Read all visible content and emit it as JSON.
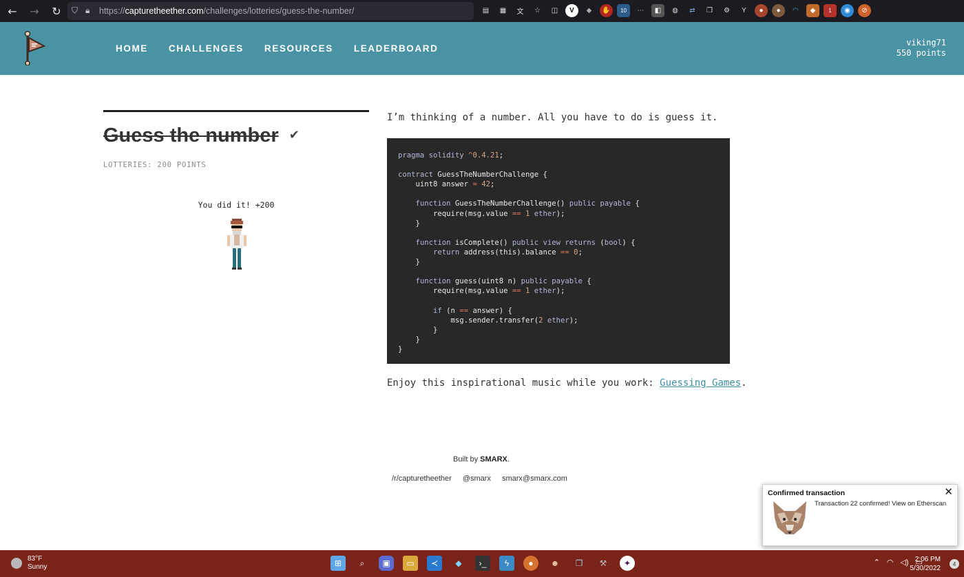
{
  "browser": {
    "url_scheme": "https://",
    "url_host": "capturetheether.com",
    "url_path": "/challenges/lotteries/guess-the-number/",
    "badge_10": "10",
    "badge_1": "1"
  },
  "header": {
    "nav": [
      "HOME",
      "CHALLENGES",
      "RESOURCES",
      "LEADERBOARD"
    ],
    "username": "viking71",
    "points": "550 points",
    "bg_color": "#4a93a4"
  },
  "challenge": {
    "title": "Guess the number",
    "check_icon": "✔",
    "subtitle": "LOTTERIES: 200 POINTS",
    "success_text": "You did it! +200"
  },
  "content": {
    "intro": "I’m thinking of a number. All you have to do is guess it.",
    "code_lines": [
      "pragma solidity ^0.4.21;",
      "",
      "contract GuessTheNumberChallenge {",
      "    uint8 answer = 42;",
      "",
      "    function GuessTheNumberChallenge() public payable {",
      "        require(msg.value == 1 ether);",
      "    }",
      "",
      "    function isComplete() public view returns (bool) {",
      "        return address(this).balance == 0;",
      "    }",
      "",
      "    function guess(uint8 n) public payable {",
      "        require(msg.value == 1 ether);",
      "",
      "        if (n == answer) {",
      "            msg.sender.transfer(2 ether);",
      "        }",
      "    }",
      "}"
    ],
    "music_prefix": "Enjoy this inspirational music while you work: ",
    "music_link": "Guessing Games",
    "music_suffix": "."
  },
  "footer": {
    "built_prefix": "Built by ",
    "built_name": "SMARX",
    "built_suffix": ".",
    "links": [
      "/r/capturetheether",
      "@smarx",
      "smarx@smarx.com"
    ]
  },
  "toast": {
    "title": "Confirmed transaction",
    "body": "Transaction 22 confirmed! View on Etherscan",
    "close": "✕"
  },
  "taskbar": {
    "temperature": "83°F",
    "condition": "Sunny",
    "time": "2:06 PM",
    "date": "5/30/2022",
    "notification_count": "4",
    "color": "#7a2318"
  }
}
